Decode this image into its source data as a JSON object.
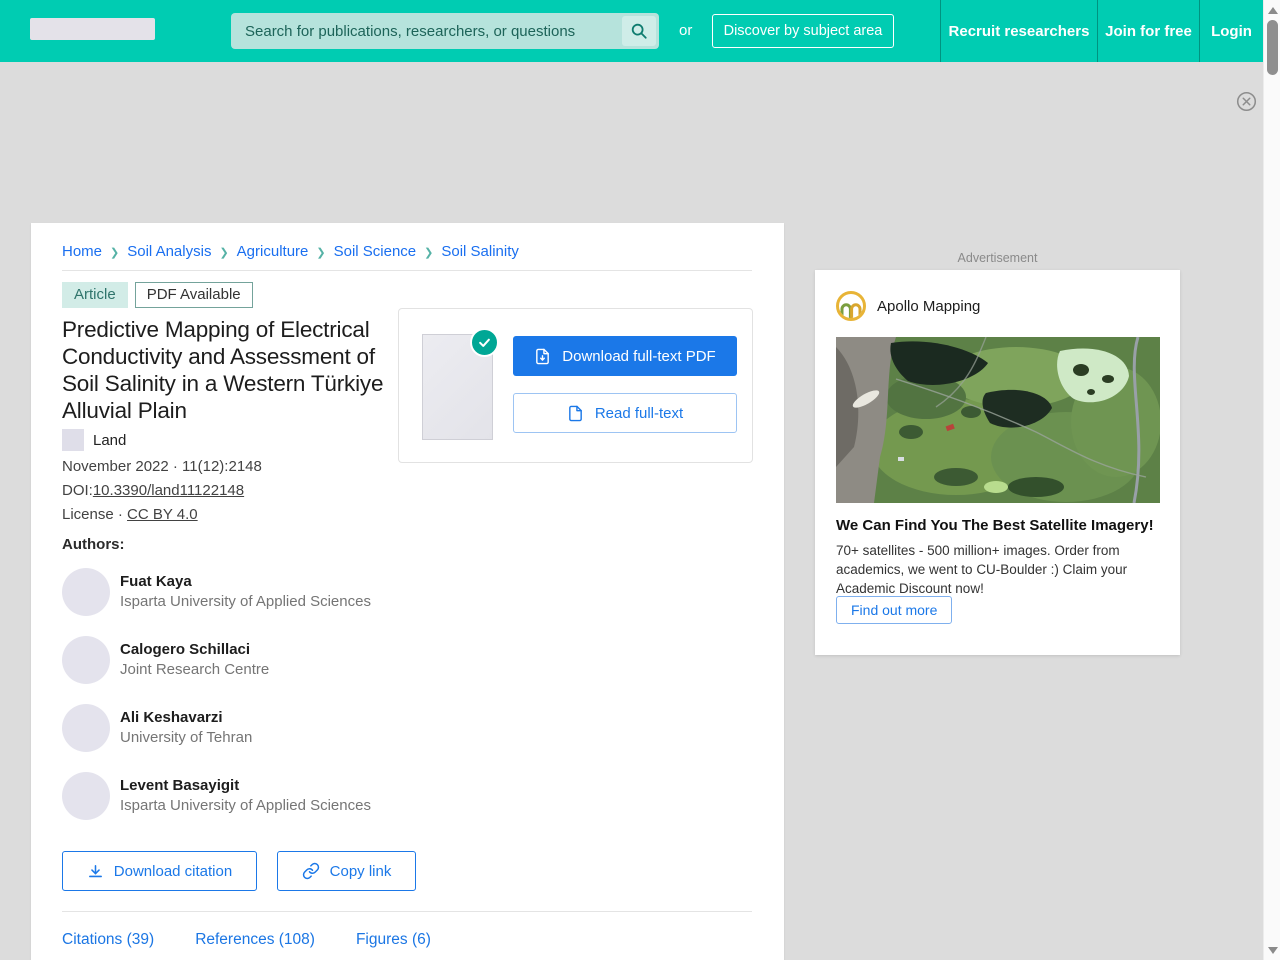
{
  "header": {
    "search_placeholder": "Search for publications, researchers, or questions",
    "or_label": "or",
    "discover_button": "Discover by subject area",
    "nav": [
      {
        "label": "Recruit researchers"
      },
      {
        "label": "Join for free"
      },
      {
        "label": "Login"
      }
    ]
  },
  "breadcrumb": {
    "items": [
      {
        "label": "Home"
      },
      {
        "label": "Soil Analysis"
      },
      {
        "label": "Agriculture"
      },
      {
        "label": "Soil Science"
      },
      {
        "label": "Soil Salinity"
      }
    ]
  },
  "article": {
    "tags": {
      "type": "Article",
      "availability": "PDF Available"
    },
    "title": "Predictive Mapping of Electrical Conductivity and Assessment of Soil Salinity in a Western Türkiye Alluvial Plain",
    "journal": "Land",
    "meta_line": "November 2022 · 11(12):2148",
    "doi_label": "DOI:",
    "doi_value": "10.3390/land11122148",
    "license_label": "License ·",
    "license_value": "CC BY 4.0",
    "authors_label": "Authors:",
    "authors": [
      {
        "name": "Fuat Kaya",
        "affiliation": "Isparta University of Applied Sciences"
      },
      {
        "name": "Calogero Schillaci",
        "affiliation": "Joint Research Centre"
      },
      {
        "name": "Ali Keshavarzi",
        "affiliation": "University of Tehran"
      },
      {
        "name": "Levent Basayigit",
        "affiliation": "Isparta University of Applied Sciences"
      }
    ],
    "actions": {
      "download_pdf": "Download full-text PDF",
      "read_fulltext": "Read full-text",
      "download_citation": "Download citation",
      "copy_link": "Copy link"
    },
    "tabs": [
      {
        "label": "Citations (39)"
      },
      {
        "label": "References (108)"
      },
      {
        "label": "Figures (6)"
      }
    ]
  },
  "ad": {
    "label": "Advertisement",
    "brand": "Apollo Mapping",
    "headline": "We Can Find You The Best Satellite Imagery!",
    "body": "70+ satellites - 500 million+ images. Order from academics, we went to CU-Boulder :) Claim your Academic Discount now!",
    "cta": "Find out more"
  },
  "icons": {
    "search": "magnifier",
    "breadcrumb_separator": "❯",
    "close": "circled-x",
    "check": "checkmark",
    "download_pdf": "file-with-down-arrow",
    "read": "file-outline",
    "download_citation": "down-arrow-to-tray",
    "copy_link": "chain-link",
    "scroll_up": "triangle-up",
    "scroll_down": "triangle-down"
  },
  "colors": {
    "header_teal": "#00ccb2",
    "button_blue": "#1b78e8",
    "link_blue": "#1a6ff0",
    "check_teal": "#00a795",
    "page_bg": "#dcdcdc",
    "tag_bg": "#d2ece7",
    "gold_logo_ring": "#e8b437"
  }
}
